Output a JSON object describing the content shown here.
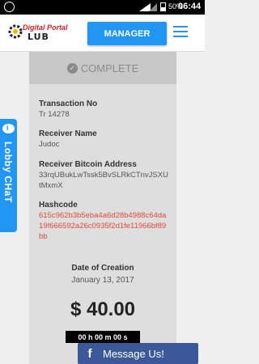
{
  "status_bar": {
    "battery": "50%",
    "time": "06:44"
  },
  "header": {
    "logo_line1": "Digital Portal",
    "logo_line2": "LUB",
    "manager_label": "MANAGER"
  },
  "card": {
    "status": "COMPLETE",
    "transaction_label": "Transaction No",
    "transaction_value": "Tr 14278",
    "receiver_name_label": "Receiver Name",
    "receiver_name_value": "Judoc",
    "receiver_address_label": "Receiver Bitcoin Address",
    "receiver_address_value": "33rqUBukLwTssk5BvSLRkCTnvJSXUtMxmX",
    "hashcode_label": "Hashcode",
    "hashcode_value": "615c962b3b5eba4a6d28b4988c64da19f666592a26c0935f2d1fe11966bf89bb",
    "date_label": "Date of Creation",
    "date_value": "January 13, 2017",
    "amount": "$ 40.00",
    "timer": "00 h 00 m 00 s"
  },
  "lobby_chat": {
    "label": "Lobby CHaT"
  },
  "facebook": {
    "label": "Message Us!",
    "icon": "f"
  },
  "colors": {
    "accent": "#2196f3",
    "hash": "#e24a3b",
    "facebook": "#3b5998"
  }
}
